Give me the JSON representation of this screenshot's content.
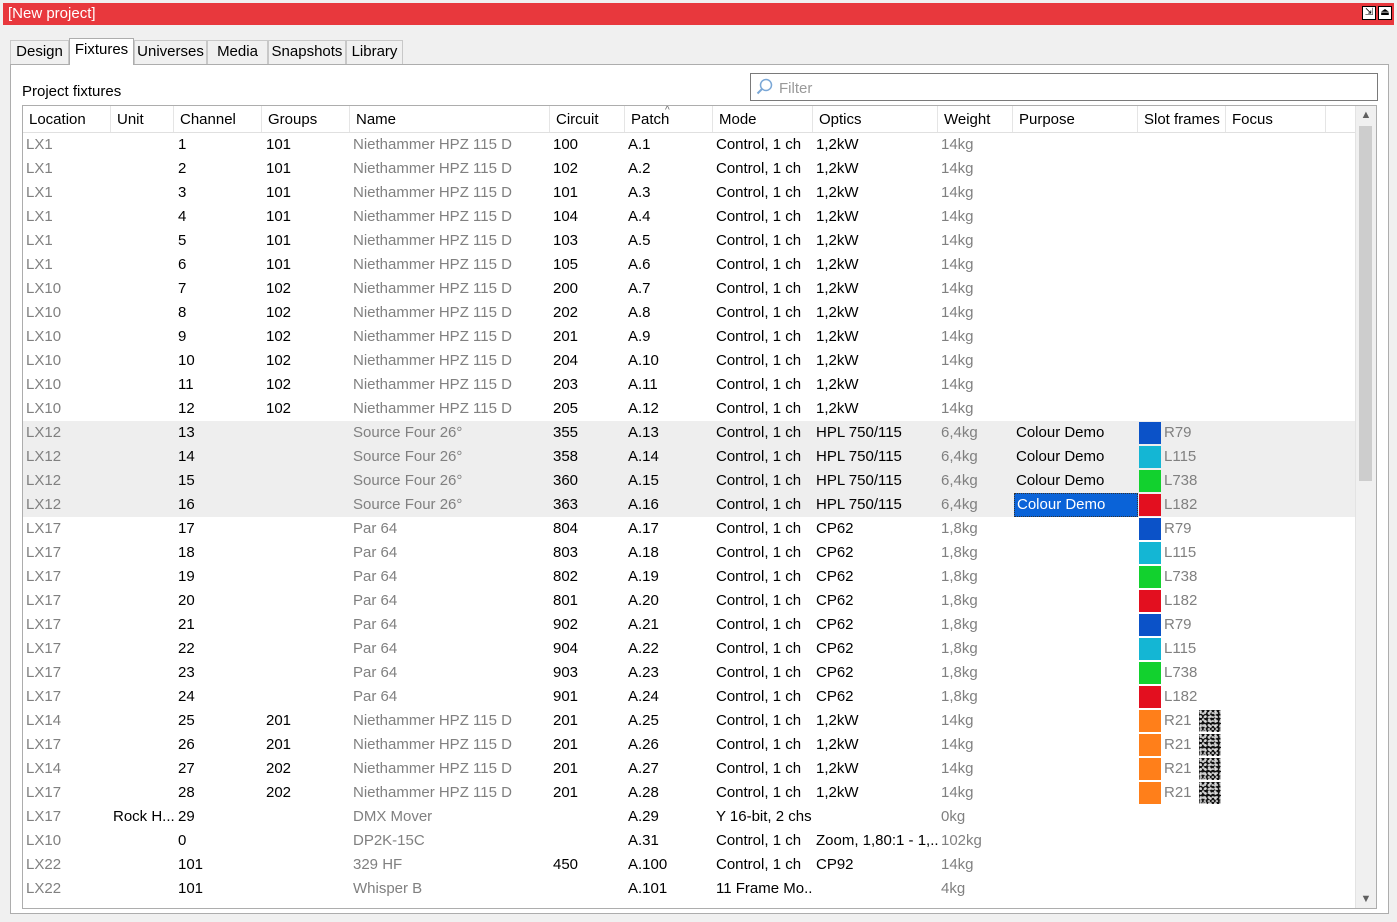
{
  "window": {
    "title": "[New project]"
  },
  "tabs": [
    "Design",
    "Fixtures",
    "Universes",
    "Media",
    "Snapshots",
    "Library"
  ],
  "active_tab": "Fixtures",
  "section_label": "Project fixtures",
  "filter": {
    "placeholder": "Filter",
    "value": ""
  },
  "sort_column": "Patch",
  "columns": [
    "Location",
    "Unit",
    "Channel",
    "Groups",
    "Name",
    "Circuit",
    "Patch",
    "Mode",
    "Optics",
    "Weight",
    "Purpose",
    "Slot frames",
    "Focus"
  ],
  "swatch_colors": {
    "blue": "#0b52c8",
    "cyan": "#14b6d4",
    "green": "#12d12e",
    "red": "#e30f1f",
    "orange": "#ff7f1a"
  },
  "selected_cell": {
    "row": 15,
    "column": "Purpose"
  },
  "rows": [
    {
      "location": "LX1",
      "unit": "",
      "channel": "1",
      "groups": "101",
      "name": "Niethammer HPZ 115 D",
      "circuit": "100",
      "patch": "A.1",
      "mode": "Control, 1 ch",
      "optics": "1,2kW",
      "weight": "14kg",
      "purpose": "",
      "slot_color": "",
      "slot_label": "",
      "gobo": false
    },
    {
      "location": "LX1",
      "unit": "",
      "channel": "2",
      "groups": "101",
      "name": "Niethammer HPZ 115 D",
      "circuit": "102",
      "patch": "A.2",
      "mode": "Control, 1 ch",
      "optics": "1,2kW",
      "weight": "14kg",
      "purpose": "",
      "slot_color": "",
      "slot_label": "",
      "gobo": false
    },
    {
      "location": "LX1",
      "unit": "",
      "channel": "3",
      "groups": "101",
      "name": "Niethammer HPZ 115 D",
      "circuit": "101",
      "patch": "A.3",
      "mode": "Control, 1 ch",
      "optics": "1,2kW",
      "weight": "14kg",
      "purpose": "",
      "slot_color": "",
      "slot_label": "",
      "gobo": false
    },
    {
      "location": "LX1",
      "unit": "",
      "channel": "4",
      "groups": "101",
      "name": "Niethammer HPZ 115 D",
      "circuit": "104",
      "patch": "A.4",
      "mode": "Control, 1 ch",
      "optics": "1,2kW",
      "weight": "14kg",
      "purpose": "",
      "slot_color": "",
      "slot_label": "",
      "gobo": false
    },
    {
      "location": "LX1",
      "unit": "",
      "channel": "5",
      "groups": "101",
      "name": "Niethammer HPZ 115 D",
      "circuit": "103",
      "patch": "A.5",
      "mode": "Control, 1 ch",
      "optics": "1,2kW",
      "weight": "14kg",
      "purpose": "",
      "slot_color": "",
      "slot_label": "",
      "gobo": false
    },
    {
      "location": "LX1",
      "unit": "",
      "channel": "6",
      "groups": "101",
      "name": "Niethammer HPZ 115 D",
      "circuit": "105",
      "patch": "A.6",
      "mode": "Control, 1 ch",
      "optics": "1,2kW",
      "weight": "14kg",
      "purpose": "",
      "slot_color": "",
      "slot_label": "",
      "gobo": false
    },
    {
      "location": "LX10",
      "unit": "",
      "channel": "7",
      "groups": "102",
      "name": "Niethammer HPZ 115 D",
      "circuit": "200",
      "patch": "A.7",
      "mode": "Control, 1 ch",
      "optics": "1,2kW",
      "weight": "14kg",
      "purpose": "",
      "slot_color": "",
      "slot_label": "",
      "gobo": false
    },
    {
      "location": "LX10",
      "unit": "",
      "channel": "8",
      "groups": "102",
      "name": "Niethammer HPZ 115 D",
      "circuit": "202",
      "patch": "A.8",
      "mode": "Control, 1 ch",
      "optics": "1,2kW",
      "weight": "14kg",
      "purpose": "",
      "slot_color": "",
      "slot_label": "",
      "gobo": false
    },
    {
      "location": "LX10",
      "unit": "",
      "channel": "9",
      "groups": "102",
      "name": "Niethammer HPZ 115 D",
      "circuit": "201",
      "patch": "A.9",
      "mode": "Control, 1 ch",
      "optics": "1,2kW",
      "weight": "14kg",
      "purpose": "",
      "slot_color": "",
      "slot_label": "",
      "gobo": false
    },
    {
      "location": "LX10",
      "unit": "",
      "channel": "10",
      "groups": "102",
      "name": "Niethammer HPZ 115 D",
      "circuit": "204",
      "patch": "A.10",
      "mode": "Control, 1 ch",
      "optics": "1,2kW",
      "weight": "14kg",
      "purpose": "",
      "slot_color": "",
      "slot_label": "",
      "gobo": false
    },
    {
      "location": "LX10",
      "unit": "",
      "channel": "11",
      "groups": "102",
      "name": "Niethammer HPZ 115 D",
      "circuit": "203",
      "patch": "A.11",
      "mode": "Control, 1 ch",
      "optics": "1,2kW",
      "weight": "14kg",
      "purpose": "",
      "slot_color": "",
      "slot_label": "",
      "gobo": false
    },
    {
      "location": "LX10",
      "unit": "",
      "channel": "12",
      "groups": "102",
      "name": "Niethammer HPZ 115 D",
      "circuit": "205",
      "patch": "A.12",
      "mode": "Control, 1 ch",
      "optics": "1,2kW",
      "weight": "14kg",
      "purpose": "",
      "slot_color": "",
      "slot_label": "",
      "gobo": false
    },
    {
      "location": "LX12",
      "unit": "",
      "channel": "13",
      "groups": "",
      "name": "Source Four 26°",
      "circuit": "355",
      "patch": "A.13",
      "mode": "Control, 1 ch",
      "optics": "HPL 750/115",
      "weight": "6,4kg",
      "purpose": "Colour Demo",
      "slot_color": "blue",
      "slot_label": "R79",
      "gobo": false,
      "selected": true
    },
    {
      "location": "LX12",
      "unit": "",
      "channel": "14",
      "groups": "",
      "name": "Source Four 26°",
      "circuit": "358",
      "patch": "A.14",
      "mode": "Control, 1 ch",
      "optics": "HPL 750/115",
      "weight": "6,4kg",
      "purpose": "Colour Demo",
      "slot_color": "cyan",
      "slot_label": "L115",
      "gobo": false,
      "selected": true
    },
    {
      "location": "LX12",
      "unit": "",
      "channel": "15",
      "groups": "",
      "name": "Source Four 26°",
      "circuit": "360",
      "patch": "A.15",
      "mode": "Control, 1 ch",
      "optics": "HPL 750/115",
      "weight": "6,4kg",
      "purpose": "Colour Demo",
      "slot_color": "green",
      "slot_label": "L738",
      "gobo": false,
      "selected": true
    },
    {
      "location": "LX12",
      "unit": "",
      "channel": "16",
      "groups": "",
      "name": "Source Four 26°",
      "circuit": "363",
      "patch": "A.16",
      "mode": "Control, 1 ch",
      "optics": "HPL 750/115",
      "weight": "6,4kg",
      "purpose": "Colour Demo",
      "slot_color": "red",
      "slot_label": "L182",
      "gobo": false,
      "selected": true
    },
    {
      "location": "LX17",
      "unit": "",
      "channel": "17",
      "groups": "",
      "name": "Par 64",
      "circuit": "804",
      "patch": "A.17",
      "mode": "Control, 1 ch",
      "optics": "CP62",
      "weight": "1,8kg",
      "purpose": "",
      "slot_color": "blue",
      "slot_label": "R79",
      "gobo": false
    },
    {
      "location": "LX17",
      "unit": "",
      "channel": "18",
      "groups": "",
      "name": "Par 64",
      "circuit": "803",
      "patch": "A.18",
      "mode": "Control, 1 ch",
      "optics": "CP62",
      "weight": "1,8kg",
      "purpose": "",
      "slot_color": "cyan",
      "slot_label": "L115",
      "gobo": false
    },
    {
      "location": "LX17",
      "unit": "",
      "channel": "19",
      "groups": "",
      "name": "Par 64",
      "circuit": "802",
      "patch": "A.19",
      "mode": "Control, 1 ch",
      "optics": "CP62",
      "weight": "1,8kg",
      "purpose": "",
      "slot_color": "green",
      "slot_label": "L738",
      "gobo": false
    },
    {
      "location": "LX17",
      "unit": "",
      "channel": "20",
      "groups": "",
      "name": "Par 64",
      "circuit": "801",
      "patch": "A.20",
      "mode": "Control, 1 ch",
      "optics": "CP62",
      "weight": "1,8kg",
      "purpose": "",
      "slot_color": "red",
      "slot_label": "L182",
      "gobo": false
    },
    {
      "location": "LX17",
      "unit": "",
      "channel": "21",
      "groups": "",
      "name": "Par 64",
      "circuit": "902",
      "patch": "A.21",
      "mode": "Control, 1 ch",
      "optics": "CP62",
      "weight": "1,8kg",
      "purpose": "",
      "slot_color": "blue",
      "slot_label": "R79",
      "gobo": false
    },
    {
      "location": "LX17",
      "unit": "",
      "channel": "22",
      "groups": "",
      "name": "Par 64",
      "circuit": "904",
      "patch": "A.22",
      "mode": "Control, 1 ch",
      "optics": "CP62",
      "weight": "1,8kg",
      "purpose": "",
      "slot_color": "cyan",
      "slot_label": "L115",
      "gobo": false
    },
    {
      "location": "LX17",
      "unit": "",
      "channel": "23",
      "groups": "",
      "name": "Par 64",
      "circuit": "903",
      "patch": "A.23",
      "mode": "Control, 1 ch",
      "optics": "CP62",
      "weight": "1,8kg",
      "purpose": "",
      "slot_color": "green",
      "slot_label": "L738",
      "gobo": false
    },
    {
      "location": "LX17",
      "unit": "",
      "channel": "24",
      "groups": "",
      "name": "Par 64",
      "circuit": "901",
      "patch": "A.24",
      "mode": "Control, 1 ch",
      "optics": "CP62",
      "weight": "1,8kg",
      "purpose": "",
      "slot_color": "red",
      "slot_label": "L182",
      "gobo": false
    },
    {
      "location": "LX14",
      "unit": "",
      "channel": "25",
      "groups": "201",
      "name": "Niethammer HPZ 115 D",
      "circuit": "201",
      "patch": "A.25",
      "mode": "Control, 1 ch",
      "optics": "1,2kW",
      "weight": "14kg",
      "purpose": "",
      "slot_color": "orange",
      "slot_label": "R21",
      "gobo": true
    },
    {
      "location": "LX17",
      "unit": "",
      "channel": "26",
      "groups": "201",
      "name": "Niethammer HPZ 115 D",
      "circuit": "201",
      "patch": "A.26",
      "mode": "Control, 1 ch",
      "optics": "1,2kW",
      "weight": "14kg",
      "purpose": "",
      "slot_color": "orange",
      "slot_label": "R21",
      "gobo": true
    },
    {
      "location": "LX14",
      "unit": "",
      "channel": "27",
      "groups": "202",
      "name": "Niethammer HPZ 115 D",
      "circuit": "201",
      "patch": "A.27",
      "mode": "Control, 1 ch",
      "optics": "1,2kW",
      "weight": "14kg",
      "purpose": "",
      "slot_color": "orange",
      "slot_label": "R21",
      "gobo": true
    },
    {
      "location": "LX17",
      "unit": "",
      "channel": "28",
      "groups": "202",
      "name": "Niethammer HPZ 115 D",
      "circuit": "201",
      "patch": "A.28",
      "mode": "Control, 1 ch",
      "optics": "1,2kW",
      "weight": "14kg",
      "purpose": "",
      "slot_color": "orange",
      "slot_label": "R21",
      "gobo": true
    },
    {
      "location": "LX17",
      "unit": "Rock H...",
      "channel": "29",
      "groups": "",
      "name": "DMX Mover",
      "circuit": "",
      "patch": "A.29",
      "mode": "Y 16-bit, 2 chs",
      "optics": "",
      "weight": "0kg",
      "purpose": "",
      "slot_color": "",
      "slot_label": "",
      "gobo": false
    },
    {
      "location": "LX10",
      "unit": "",
      "channel": "0",
      "groups": "",
      "name": "DP2K-15C",
      "circuit": "",
      "patch": "A.31",
      "mode": "Control, 1 ch",
      "optics": "Zoom, 1,80:1 - 1,...",
      "weight": "102kg",
      "purpose": "",
      "slot_color": "",
      "slot_label": "",
      "gobo": false
    },
    {
      "location": "LX22",
      "unit": "",
      "channel": "101",
      "groups": "",
      "name": "329 HF",
      "circuit": "450",
      "patch": "A.100",
      "mode": "Control, 1 ch",
      "optics": "CP92",
      "weight": "14kg",
      "purpose": "",
      "slot_color": "",
      "slot_label": "",
      "gobo": false
    },
    {
      "location": "LX22",
      "unit": "",
      "channel": "101",
      "groups": "",
      "name": "Whisper B",
      "circuit": "",
      "patch": "A.101",
      "mode": "11 Frame Mo...",
      "optics": "",
      "weight": "4kg",
      "purpose": "",
      "slot_color": "",
      "slot_label": "",
      "gobo": false
    }
  ]
}
